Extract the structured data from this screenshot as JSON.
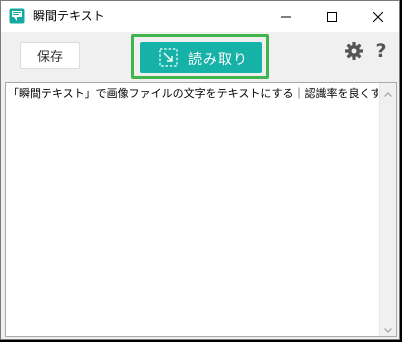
{
  "window": {
    "title": "瞬間テキスト",
    "app_icon": "app-logo-icon",
    "controls": {
      "minimize_icon": "minimize-icon",
      "maximize_icon": "maximize-icon",
      "close_icon": "close-icon"
    }
  },
  "toolbar": {
    "save_label": "保存",
    "read_label": "読み取り",
    "read_icon": "screen-capture-icon",
    "settings_icon": "gear-icon",
    "help_label": "?"
  },
  "editor": {
    "text": "「瞬間テキスト」で画像ファイルの文字をテキストにする｜認識率を良くする"
  },
  "colors": {
    "read_button": "#16b2a8",
    "highlight_border": "#3fb54c",
    "window_bg": "#f0f0f0"
  }
}
